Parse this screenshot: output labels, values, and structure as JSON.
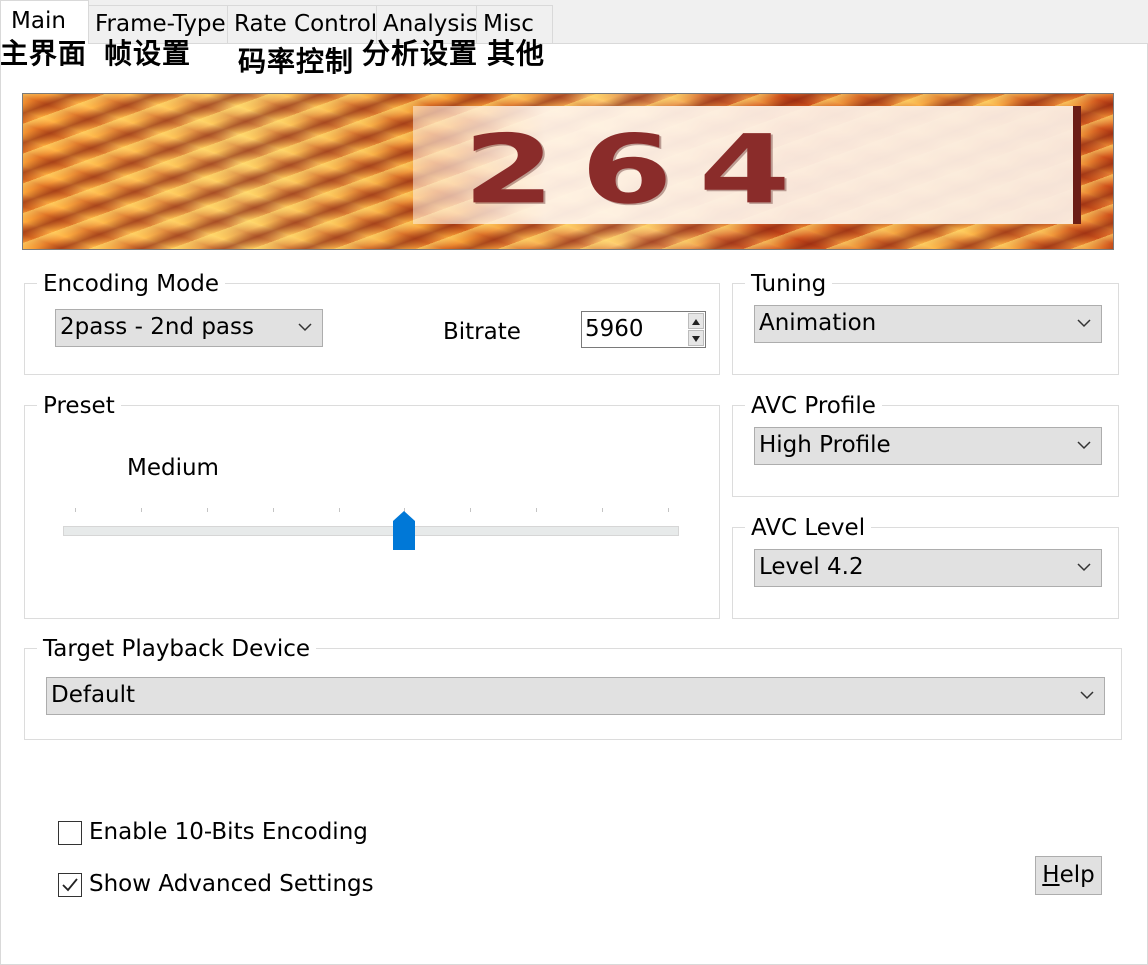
{
  "tabs": [
    {
      "label": "Main",
      "active": true
    },
    {
      "label": "Frame-Type",
      "active": false
    },
    {
      "label": "Rate Control",
      "active": false
    },
    {
      "label": "Analysis",
      "active": false
    },
    {
      "label": "Misc",
      "active": false
    }
  ],
  "overlay_annotations": [
    "主界面",
    "帧设置",
    "码率控制",
    "分析设置",
    "其他"
  ],
  "banner": {
    "text": "264"
  },
  "encoding_mode": {
    "legend": "Encoding Mode",
    "mode_value": "2pass - 2nd pass",
    "bitrate_label": "Bitrate",
    "bitrate_value": "5960"
  },
  "tuning": {
    "legend": "Tuning",
    "value": "Animation"
  },
  "preset": {
    "legend": "Preset",
    "value_label": "Medium",
    "level_index": 5,
    "tick_count": 10
  },
  "avc_profile": {
    "legend": "AVC Profile",
    "value": "High Profile"
  },
  "avc_level": {
    "legend": "AVC Level",
    "value": "Level 4.2"
  },
  "target_device": {
    "legend": "Target Playback Device",
    "value": "Default"
  },
  "options": {
    "enable_10bit": {
      "label": "Enable 10-Bits Encoding",
      "checked": false
    },
    "show_advanced": {
      "label": "Show Advanced Settings",
      "checked": true
    }
  },
  "help": {
    "label_prefix": "H",
    "label_rest": "elp"
  },
  "colors": {
    "accent": "#0078d7",
    "banner_text": "#8a2c2a"
  }
}
